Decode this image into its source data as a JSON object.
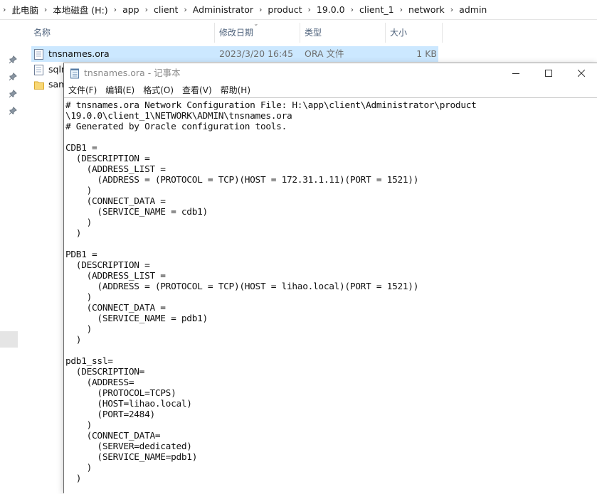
{
  "explorer": {
    "breadcrumb": [
      "此电脑",
      "本地磁盘 (H:)",
      "app",
      "client",
      "Administrator",
      "product",
      "19.0.0",
      "client_1",
      "network",
      "admin"
    ],
    "columns": {
      "name": "名称",
      "date": "修改日期",
      "type": "类型",
      "size": "大小"
    },
    "files": [
      {
        "name": "tnsnames.ora",
        "date": "2023/3/20 16:45",
        "type": "ORA 文件",
        "size": "1 KB",
        "icon": "document-icon"
      },
      {
        "name": "sqlnet.ora",
        "icon": "document-icon"
      },
      {
        "name": "samples",
        "icon": "folder-icon"
      }
    ]
  },
  "notepad": {
    "title": "tnsnames.ora - 记事本",
    "menu": [
      "文件(F)",
      "编辑(E)",
      "格式(O)",
      "查看(V)",
      "帮助(H)"
    ],
    "content": "# tnsnames.ora Network Configuration File: H:\\app\\client\\Administrator\\product\n\\19.0.0\\client_1\\NETWORK\\ADMIN\\tnsnames.ora\n# Generated by Oracle configuration tools.\n\nCDB1 =\n  (DESCRIPTION =\n    (ADDRESS_LIST =\n      (ADDRESS = (PROTOCOL = TCP)(HOST = 172.31.1.11)(PORT = 1521))\n    )\n    (CONNECT_DATA =\n      (SERVICE_NAME = cdb1)\n    )\n  )\n\nPDB1 =\n  (DESCRIPTION =\n    (ADDRESS_LIST =\n      (ADDRESS = (PROTOCOL = TCP)(HOST = lihao.local)(PORT = 1521))\n    )\n    (CONNECT_DATA =\n      (SERVICE_NAME = pdb1)\n    )\n  )\n\npdb1_ssl=\n  (DESCRIPTION=\n    (ADDRESS=\n      (PROTOCOL=TCPS)\n      (HOST=lihao.local)\n      (PORT=2484)\n    )\n    (CONNECT_DATA=\n      (SERVER=dedicated)\n      (SERVICE_NAME=pdb1)\n    )\n  )"
  }
}
